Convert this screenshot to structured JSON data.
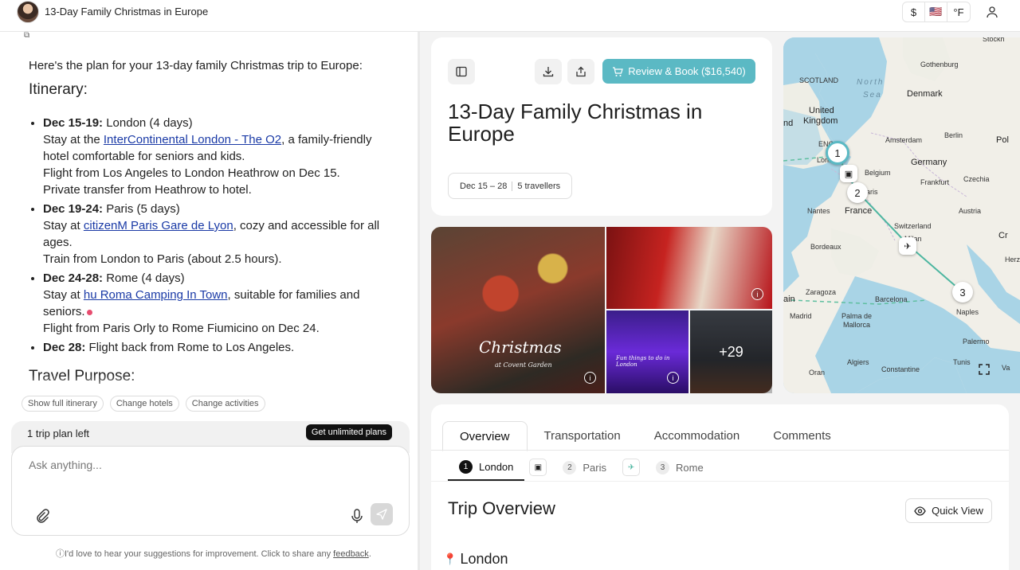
{
  "header": {
    "title": "13-Day Family Christmas in Europe",
    "currency": "$",
    "flag": "🇺🇸",
    "temp_unit": "°F"
  },
  "chat": {
    "intro": "Here's the plan for your 13-day family Christmas trip to Europe:",
    "itinerary_heading": "Itinerary:",
    "items": [
      {
        "date": "Dec 15-19:",
        "place": " London (4 days)",
        "lines": [
          {
            "pre": "Stay at the ",
            "link": "InterContinental London - The O2",
            "post": ", a family-friendly hotel comfortable for seniors and kids."
          },
          {
            "text": "Flight from Los Angeles to London Heathrow on Dec 15."
          },
          {
            "text": "Private transfer from Heathrow to hotel."
          }
        ]
      },
      {
        "date": "Dec 19-24:",
        "place": " Paris (5 days)",
        "lines": [
          {
            "pre": "Stay at ",
            "link": "citizenM Paris Gare de Lyon",
            "post": ", cozy and accessible for all ages."
          },
          {
            "text": "Train from London to Paris (about 2.5 hours)."
          }
        ]
      },
      {
        "date": "Dec 24-28:",
        "place": " Rome (4 days)",
        "lines": [
          {
            "pre": "Stay at ",
            "link": "hu Roma Camping In Town",
            "post": ", suitable for families and seniors."
          },
          {
            "text": "Flight from Paris Orly to Rome Fiumicino on Dec 24."
          }
        ]
      },
      {
        "date": "Dec 28:",
        "place": " Flight back from Rome to Los Angeles.",
        "lines": []
      }
    ],
    "purpose_heading": "Travel Purpose:"
  },
  "chips": [
    "Show full itinerary",
    "Change hotels",
    "Change activities"
  ],
  "plan_bar": {
    "left": "1 trip plan left",
    "button": "Get unlimited plans"
  },
  "composer": {
    "placeholder": "Ask anything..."
  },
  "feedback": {
    "text": "I'd love to hear your suggestions for improvement. Click to share any ",
    "link": "feedback",
    "end": "."
  },
  "plan": {
    "book_label": "Review & Book ($16,540)",
    "title": "13-Day Family Christmas in Europe",
    "dates": "Dec 15 – 28",
    "travellers": "5 travellers"
  },
  "photos": {
    "main_script": "Christmas",
    "main_sub": "at Covent Garden",
    "bl_caption": "Fun things to do in London",
    "more": "+29"
  },
  "map": {
    "labels": [
      {
        "text": "Stockh",
        "cls": "s"
      },
      {
        "text": "Gothenburg",
        "cls": "s"
      },
      {
        "text": "SCOTLAND",
        "cls": "s"
      },
      {
        "text": "North",
        "cls": "sea"
      },
      {
        "text": "Sea",
        "cls": "sea"
      },
      {
        "text": "Denmark",
        "cls": ""
      },
      {
        "text": "United",
        "cls": ""
      },
      {
        "text": "nd",
        "cls": ""
      },
      {
        "text": "Kingdom",
        "cls": ""
      },
      {
        "text": "Berlin",
        "cls": "s"
      },
      {
        "text": "Pol",
        "cls": ""
      },
      {
        "text": "Amsterdam",
        "cls": "s"
      },
      {
        "text": "ENG",
        "cls": "s"
      },
      {
        "text": "Londo",
        "cls": "s"
      },
      {
        "text": "Belgium",
        "cls": "s"
      },
      {
        "text": "Germany",
        "cls": ""
      },
      {
        "text": "Frankfurt",
        "cls": "s"
      },
      {
        "text": "Czechia",
        "cls": "s"
      },
      {
        "text": "aris",
        "cls": "s"
      },
      {
        "text": "Nantes",
        "cls": "s"
      },
      {
        "text": "France",
        "cls": ""
      },
      {
        "text": "Austria",
        "cls": "s"
      },
      {
        "text": "Switzerland",
        "cls": "s"
      },
      {
        "text": "Milan",
        "cls": "s"
      },
      {
        "text": "Cr",
        "cls": ""
      },
      {
        "text": "Bordeaux",
        "cls": "s"
      },
      {
        "text": "Herz",
        "cls": "s"
      },
      {
        "text": "Zaragoza",
        "cls": "s"
      },
      {
        "text": "ain",
        "cls": ""
      },
      {
        "text": "Barcelona",
        "cls": "s"
      },
      {
        "text": "Madrid",
        "cls": "s"
      },
      {
        "text": "Palma de",
        "cls": "s"
      },
      {
        "text": "Mallorca",
        "cls": "s"
      },
      {
        "text": "Naples",
        "cls": "s"
      },
      {
        "text": "Palermo",
        "cls": "s"
      },
      {
        "text": "Algiers",
        "cls": "s"
      },
      {
        "text": "Tunis",
        "cls": "s"
      },
      {
        "text": "Oran",
        "cls": "s"
      },
      {
        "text": "Constantine",
        "cls": "s"
      },
      {
        "text": "Va",
        "cls": "s"
      }
    ],
    "markers": [
      "1",
      "2",
      "3"
    ]
  },
  "tabs": [
    "Overview",
    "Transportation",
    "Accommodation",
    "Comments"
  ],
  "stops": [
    {
      "num": "1",
      "name": "London"
    },
    {
      "num": "2",
      "name": "Paris"
    },
    {
      "num": "3",
      "name": "Rome"
    }
  ],
  "overview": {
    "title": "Trip Overview",
    "quick_view": "Quick View",
    "city": "London"
  },
  "colors": {
    "accent": "#5bb9c4",
    "link": "#1a3aa6",
    "route": "#4db6a0"
  }
}
